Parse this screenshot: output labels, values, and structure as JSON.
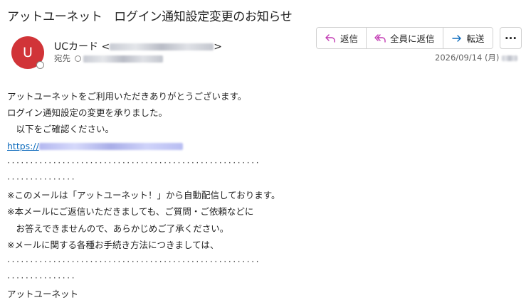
{
  "email": {
    "subject": "アットユーネット　ログイン通知設定変更のお知らせ",
    "avatar_initial": "U",
    "sender_name": "UCカード",
    "sender_open": "<",
    "sender_close": ">",
    "to_label": "宛先",
    "date": "2026/09/14 (月)"
  },
  "toolbar": {
    "reply": "返信",
    "reply_all": "全員に返信",
    "forward": "転送",
    "more": "···"
  },
  "body": {
    "line1": "アットユーネットをご利用いただきありがとうございます。",
    "line2": "ログイン通知設定の変更を承りました。",
    "line3": "　以下をご確認ください。",
    "link_prefix": "https://",
    "dots_long": "·······················································",
    "dots_short": "···············",
    "line4": "※このメールは「アットユーネット！」から自動配信しております。",
    "line5": "※本メールにご返信いただきましても、ご質問・ご依頼などに",
    "line6": "　お答えできませんので、あらかじめご了承ください。",
    "line7": "※メールに関する各種お手続き方法につきましては、",
    "signature": "アットユーネット"
  },
  "colors": {
    "avatar_bg": "#d13438",
    "link": "#0f6cbd",
    "reply_icon": "#c239b3",
    "forward_icon": "#0f6cbd"
  },
  "icons": {
    "reply": "reply-arrow-icon",
    "reply_all": "reply-all-arrow-icon",
    "forward": "forward-arrow-icon",
    "more": "more-horizontal-icon"
  }
}
